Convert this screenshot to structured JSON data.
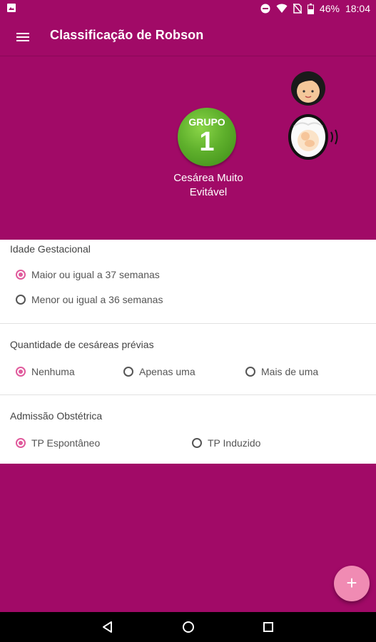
{
  "status_bar": {
    "battery": "46%",
    "time": "18:04"
  },
  "app_bar": {
    "title": "Classificação de Robson"
  },
  "group": {
    "badge_label": "GRUPO",
    "number": "1",
    "caption": "Cesárea Muito Evitável"
  },
  "sections": {
    "gestational_age": {
      "label": "Idade Gestacional",
      "options": [
        "Maior ou igual a 37 semanas",
        "Menor ou igual a 36 semanas"
      ],
      "selected": 0
    },
    "previous_cesareans": {
      "label": "Quantidade de cesáreas prévias",
      "options": [
        "Nenhuma",
        "Apenas uma",
        "Mais de uma"
      ],
      "selected": 0
    },
    "obstetric_admission": {
      "label": "Admissão Obstétrica",
      "options": [
        "TP Espontâneo",
        "TP Induzido"
      ],
      "selected": 0
    }
  },
  "fab": {
    "label": "+"
  },
  "colors": {
    "primary": "#a10a67",
    "accent": "#e05a9c",
    "fab": "#f08bb3",
    "badge_green": "#5fb02c"
  },
  "icons": [
    "menu-icon",
    "battery-icon",
    "wifi-icon",
    "dnd-icon",
    "no-sim-icon",
    "back-icon",
    "home-icon",
    "recents-icon"
  ]
}
